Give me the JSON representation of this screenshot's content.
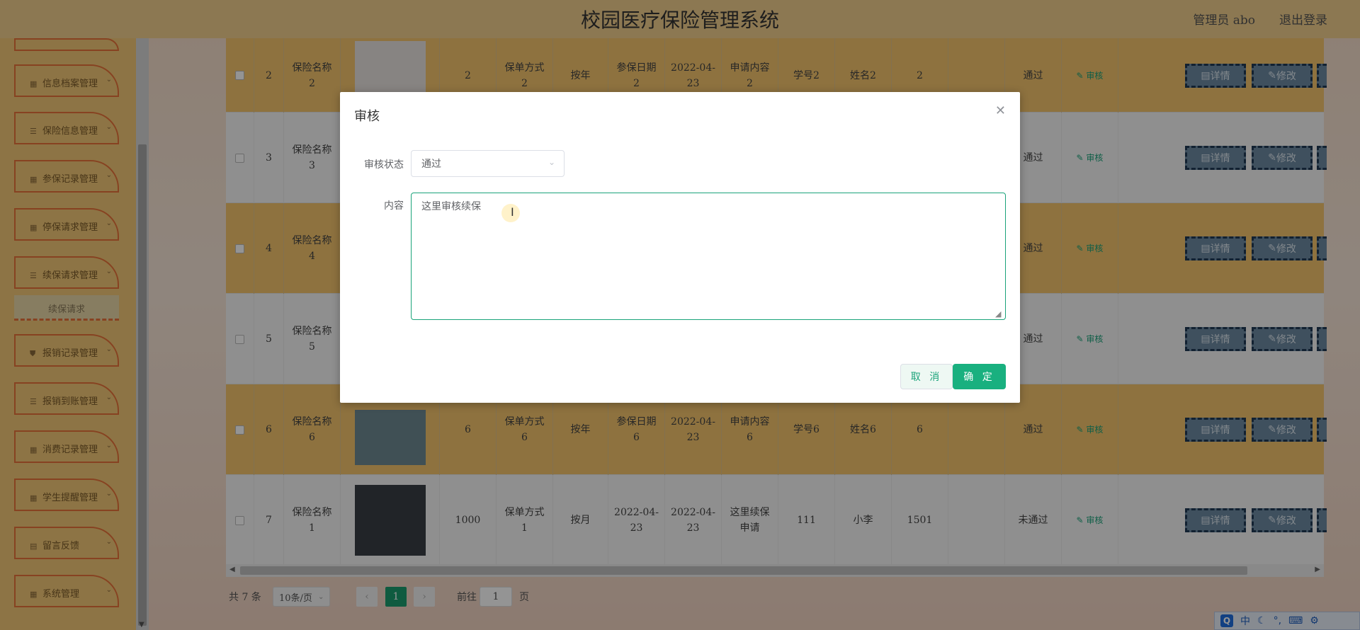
{
  "header": {
    "title": "校园医疗保险管理系统",
    "user": "管理员 abo",
    "logout": "退出登录"
  },
  "sidebar": {
    "items": [
      {
        "label": "",
        "icon": "grid-icon"
      },
      {
        "label": "信息档案管理",
        "icon": "grid-icon"
      },
      {
        "label": "保险信息管理",
        "icon": "list-icon"
      },
      {
        "label": "参保记录管理",
        "icon": "grid-icon"
      },
      {
        "label": "停保请求管理",
        "icon": "grid-icon"
      },
      {
        "label": "续保请求管理",
        "icon": "list-icon"
      },
      {
        "label": "报销记录管理",
        "icon": "shield-icon"
      },
      {
        "label": "报销到账管理",
        "icon": "list-icon"
      },
      {
        "label": "消费记录管理",
        "icon": "grid-icon"
      },
      {
        "label": "学生提醒管理",
        "icon": "grid-icon"
      },
      {
        "label": "留言反馈",
        "icon": "box-icon"
      },
      {
        "label": "系统管理",
        "icon": "grid-icon"
      }
    ],
    "sub_item": "续保请求"
  },
  "table": {
    "rows": [
      {
        "idx": "2",
        "name": "保险名称2",
        "amount": "2",
        "method": "保单方式2",
        "period": "按年",
        "insure_date": "参保日期2",
        "apply_date": "2022-04-23",
        "content": "申请内容2",
        "student_no": "学号2",
        "student_name": "姓名2",
        "phone": "2",
        "status": "通过"
      },
      {
        "idx": "3",
        "name": "保险名称3",
        "amount": "",
        "method": "",
        "period": "",
        "insure_date": "",
        "apply_date": "",
        "content": "",
        "student_no": "",
        "student_name": "",
        "phone": "",
        "status": "通过"
      },
      {
        "idx": "4",
        "name": "保险名称4",
        "amount": "",
        "method": "",
        "period": "",
        "insure_date": "",
        "apply_date": "",
        "content": "",
        "student_no": "",
        "student_name": "",
        "phone": "",
        "status": "通过"
      },
      {
        "idx": "5",
        "name": "保险名称5",
        "amount": "",
        "method": "",
        "period": "",
        "insure_date": "",
        "apply_date": "",
        "content": "",
        "student_no": "",
        "student_name": "",
        "phone": "",
        "status": "通过"
      },
      {
        "idx": "6",
        "name": "保险名称6",
        "amount": "6",
        "method": "保单方式6",
        "period": "按年",
        "insure_date": "参保日期6",
        "apply_date": "2022-04-23",
        "content": "申请内容6",
        "student_no": "学号6",
        "student_name": "姓名6",
        "phone": "6",
        "status": "通过"
      },
      {
        "idx": "7",
        "name": "保险名称1",
        "amount": "1000",
        "method": "保单方式1",
        "period": "按月",
        "insure_date": "2022-04-23",
        "apply_date": "2022-04-23",
        "content": "这里续保申请",
        "student_no": "111",
        "student_name": "小李",
        "phone": "1501",
        "status": "未通过"
      }
    ],
    "action_audit": "审核",
    "action_detail": "详情",
    "action_edit": "修改"
  },
  "pager": {
    "total": "共 7 条",
    "size": "10条/页",
    "current": "1",
    "goto_label": "前往",
    "goto_value": "1",
    "page_unit": "页"
  },
  "ime": {
    "logo": "Q",
    "lang": "中"
  },
  "dialog": {
    "title": "审核",
    "status_label": "审核状态",
    "status_value": "通过",
    "content_label": "内容",
    "content_value": "这里审核续保",
    "cancel": "取 消",
    "ok": "确 定"
  }
}
